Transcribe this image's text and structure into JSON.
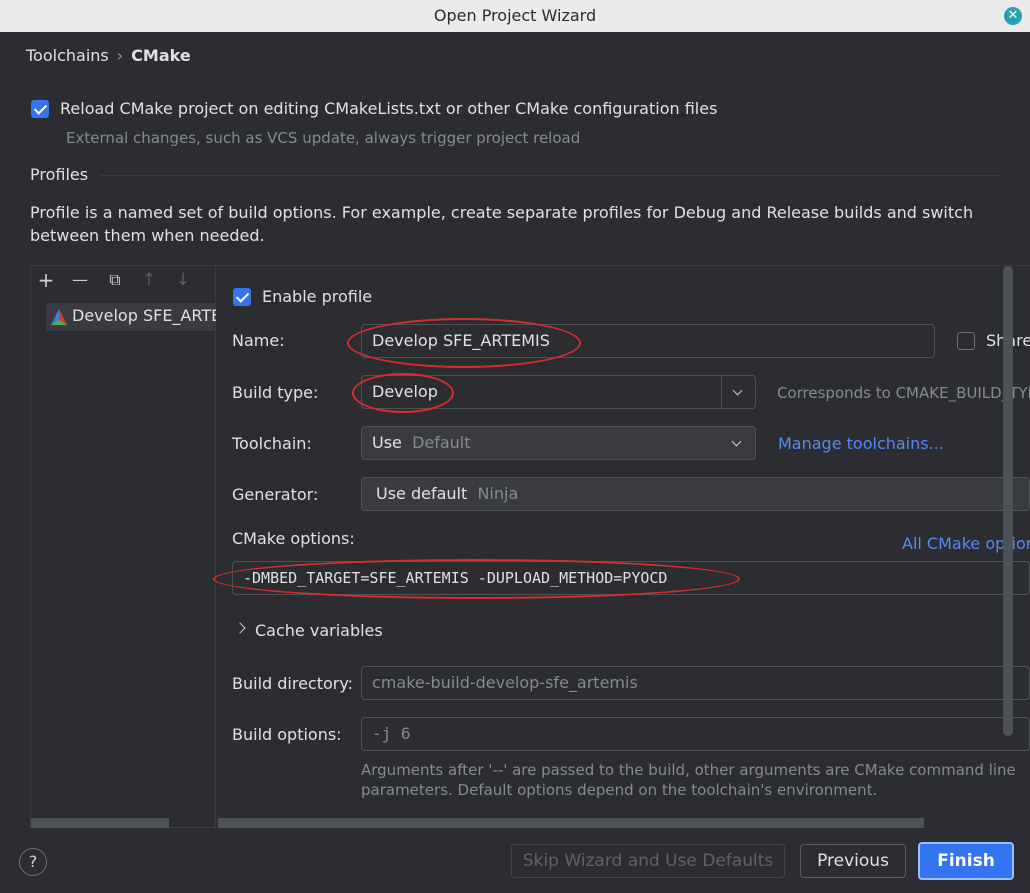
{
  "window": {
    "title": "Open Project Wizard"
  },
  "breadcrumb": {
    "parent": "Toolchains",
    "separator": "›",
    "current": "CMake"
  },
  "reload": {
    "label": "Reload CMake project on editing CMakeLists.txt or other CMake configuration files",
    "hint": "External changes, such as VCS update, always trigger project reload",
    "checked": true
  },
  "profiles": {
    "section_title": "Profiles",
    "description_line1": "Profile is a named set of build options. For example, create separate profiles for Debug and Release builds and switch",
    "description_line2": "between them when needed.",
    "toolbar": {
      "add": "+",
      "remove": "—",
      "copy": "⧉",
      "up": "↑",
      "down": "↓"
    },
    "items": [
      {
        "label": "Develop SFE_ARTEMIS",
        "icon": "cmake-icon"
      }
    ]
  },
  "profile": {
    "enable_label": "Enable profile",
    "enabled": true,
    "name_label": "Name:",
    "name_value": "Develop SFE_ARTEMIS",
    "share_label": "Share",
    "build_type_label": "Build type:",
    "build_type_value": "Develop",
    "build_type_hint": "Corresponds to CMAKE_BUILD_TYPE",
    "toolchain_label": "Toolchain:",
    "toolchain_value": "Use",
    "toolchain_default": "Default",
    "manage_toolchains": "Manage toolchains...",
    "generator_label": "Generator:",
    "generator_value": "Use default",
    "generator_default": "Ninja",
    "cmake_options_label": "CMake options:",
    "all_cmake_options": "All CMake options",
    "cmake_options_value": "-DMBED_TARGET=SFE_ARTEMIS -DUPLOAD_METHOD=PYOCD",
    "cache_variables": "Cache variables",
    "build_dir_label": "Build directory:",
    "build_dir_value": "cmake-build-develop-sfe_artemis",
    "build_options_label": "Build options:",
    "build_options_value": "-j 6",
    "build_options_hint1": "Arguments after '--' are passed to the build, other arguments are CMake command line",
    "build_options_hint2": "parameters. Default options depend on the toolchain's environment."
  },
  "buttons": {
    "help": "?",
    "skip": "Skip Wizard and Use Defaults",
    "previous": "Previous",
    "finish": "Finish"
  },
  "colors": {
    "accent": "#3574f0",
    "annotation": "#d32f2f",
    "link": "#548af7"
  }
}
